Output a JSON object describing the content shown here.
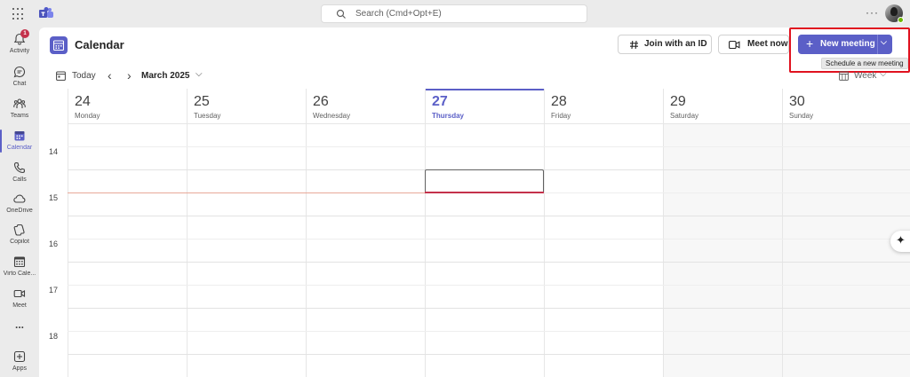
{
  "search": {
    "placeholder": "Search (Cmd+Opt+E)"
  },
  "rail": {
    "activity_badge": "1",
    "items": [
      {
        "label": "Activity"
      },
      {
        "label": "Chat"
      },
      {
        "label": "Teams"
      },
      {
        "label": "Calendar"
      },
      {
        "label": "Calls"
      },
      {
        "label": "OneDrive"
      },
      {
        "label": "Copilot"
      },
      {
        "label": "Virto Cale..."
      },
      {
        "label": "Meet"
      },
      {
        "label": "..."
      },
      {
        "label": "Apps"
      }
    ]
  },
  "header": {
    "title": "Calendar",
    "join_label": "Join with an ID",
    "meet_label": "Meet now",
    "new_meeting_label": "New meeting",
    "tooltip": "Schedule a new meeting"
  },
  "nav": {
    "today": "Today",
    "month": "March 2025",
    "view": "Week"
  },
  "days": [
    {
      "num": "24",
      "name": "Monday"
    },
    {
      "num": "25",
      "name": "Tuesday"
    },
    {
      "num": "26",
      "name": "Wednesday"
    },
    {
      "num": "27",
      "name": "Thursday"
    },
    {
      "num": "28",
      "name": "Friday"
    },
    {
      "num": "29",
      "name": "Saturday"
    },
    {
      "num": "30",
      "name": "Sunday"
    }
  ],
  "hours": [
    "14",
    "15",
    "16",
    "17",
    "18"
  ],
  "colors": {
    "accent": "#5b5fc7",
    "alert": "#c4314b",
    "highlight": "#e0121f"
  }
}
